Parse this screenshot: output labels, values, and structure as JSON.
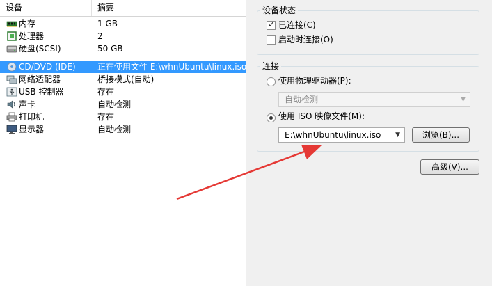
{
  "device_list": {
    "columns": {
      "device": "设备",
      "summary": "摘要"
    },
    "rows": [
      {
        "name": "内存",
        "summary": "1 GB",
        "icon": "memory-icon"
      },
      {
        "name": "处理器",
        "summary": "2",
        "icon": "processor-icon"
      },
      {
        "name": "硬盘(SCSI)",
        "summary": "50 GB",
        "icon": "hard-disk-icon"
      },
      {
        "name": "CD/DVD (IDE)",
        "summary": "正在使用文件 E:\\whnUbuntu\\linux.iso",
        "icon": "cd-dvd-icon",
        "selected": true
      },
      {
        "name": "网络适配器",
        "summary": "桥接模式(自动)",
        "icon": "network-adapter-icon"
      },
      {
        "name": "USB 控制器",
        "summary": "存在",
        "icon": "usb-icon"
      },
      {
        "name": "声卡",
        "summary": "自动检测",
        "icon": "sound-card-icon"
      },
      {
        "name": "打印机",
        "summary": "存在",
        "icon": "printer-icon"
      },
      {
        "name": "显示器",
        "summary": "自动检测",
        "icon": "display-icon"
      }
    ]
  },
  "device_status": {
    "title": "设备状态",
    "connected": {
      "label": "已连接(C)",
      "checked": true
    },
    "connect_at_power_on": {
      "label": "启动时连接(O)",
      "checked": false
    }
  },
  "connection": {
    "title": "连接",
    "physical_drive": {
      "label": "使用物理驱动器(P):",
      "selected": false
    },
    "physical_drive_select": {
      "value": "自动检测",
      "disabled": true
    },
    "iso_image": {
      "label": "使用 ISO 映像文件(M):",
      "selected": true
    },
    "iso_path_select": {
      "value": "E:\\whnUbuntu\\linux.iso"
    },
    "browse_button": "浏览(B)..."
  },
  "advanced_button": "高级(V)...",
  "colors": {
    "selection": "#3399ff",
    "annotation_arrow": "#e53935"
  }
}
